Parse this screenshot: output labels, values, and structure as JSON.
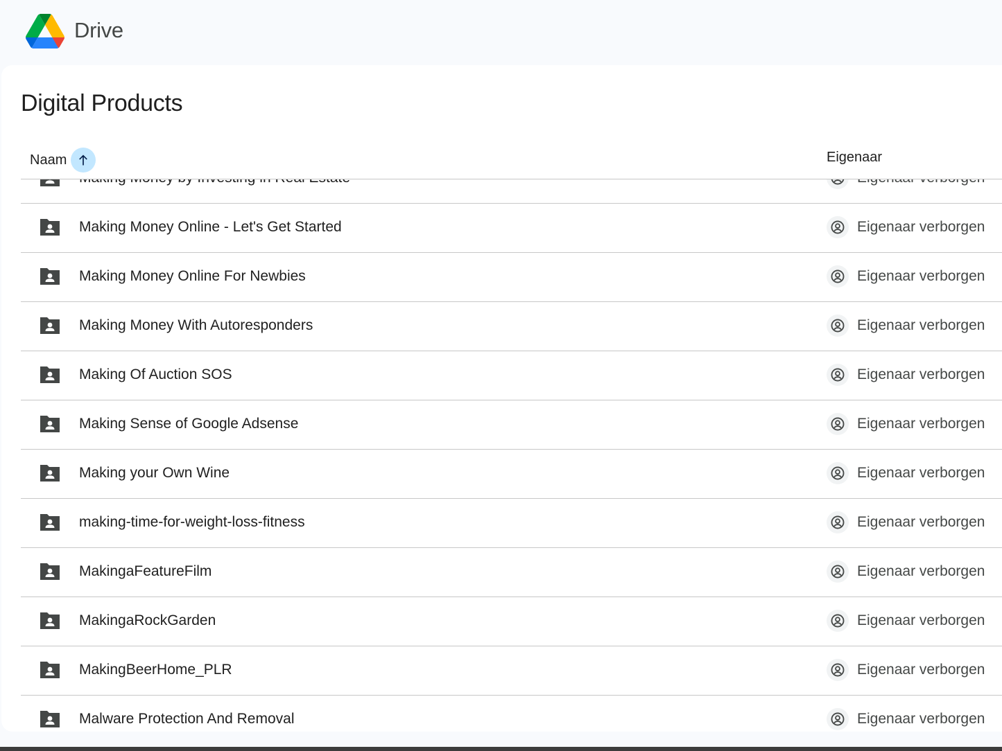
{
  "app": {
    "title": "Drive"
  },
  "folder": {
    "title": "Digital Products"
  },
  "columns": {
    "name": "Naam",
    "owner": "Eigenaar",
    "sort": "ascending"
  },
  "rows": [
    {
      "name": "Making Money by Investing in Real Estate",
      "owner": "Eigenaar verborgen"
    },
    {
      "name": "Making Money Online - Let's Get Started",
      "owner": "Eigenaar verborgen"
    },
    {
      "name": "Making Money Online For Newbies",
      "owner": "Eigenaar verborgen"
    },
    {
      "name": "Making Money With Autoresponders",
      "owner": "Eigenaar verborgen"
    },
    {
      "name": "Making Of Auction SOS",
      "owner": "Eigenaar verborgen"
    },
    {
      "name": "Making Sense of Google Adsense",
      "owner": "Eigenaar verborgen"
    },
    {
      "name": "Making your Own Wine",
      "owner": "Eigenaar verborgen"
    },
    {
      "name": "making-time-for-weight-loss-fitness",
      "owner": "Eigenaar verborgen"
    },
    {
      "name": "MakingaFeatureFilm",
      "owner": "Eigenaar verborgen"
    },
    {
      "name": "MakingaRockGarden",
      "owner": "Eigenaar verborgen"
    },
    {
      "name": "MakingBeerHome_PLR",
      "owner": "Eigenaar verborgen"
    },
    {
      "name": "Malware Protection And Removal",
      "owner": "Eigenaar verborgen"
    }
  ],
  "icons": {
    "logo": "google-drive-logo",
    "sort": "arrow-up-icon",
    "folder": "shared-folder-icon",
    "owner": "account-circle-icon"
  },
  "colors": {
    "accent": "#c2e7ff",
    "sort_arrow": "#041e49",
    "background": "#f8fafd",
    "divider": "#c7c7c7"
  }
}
